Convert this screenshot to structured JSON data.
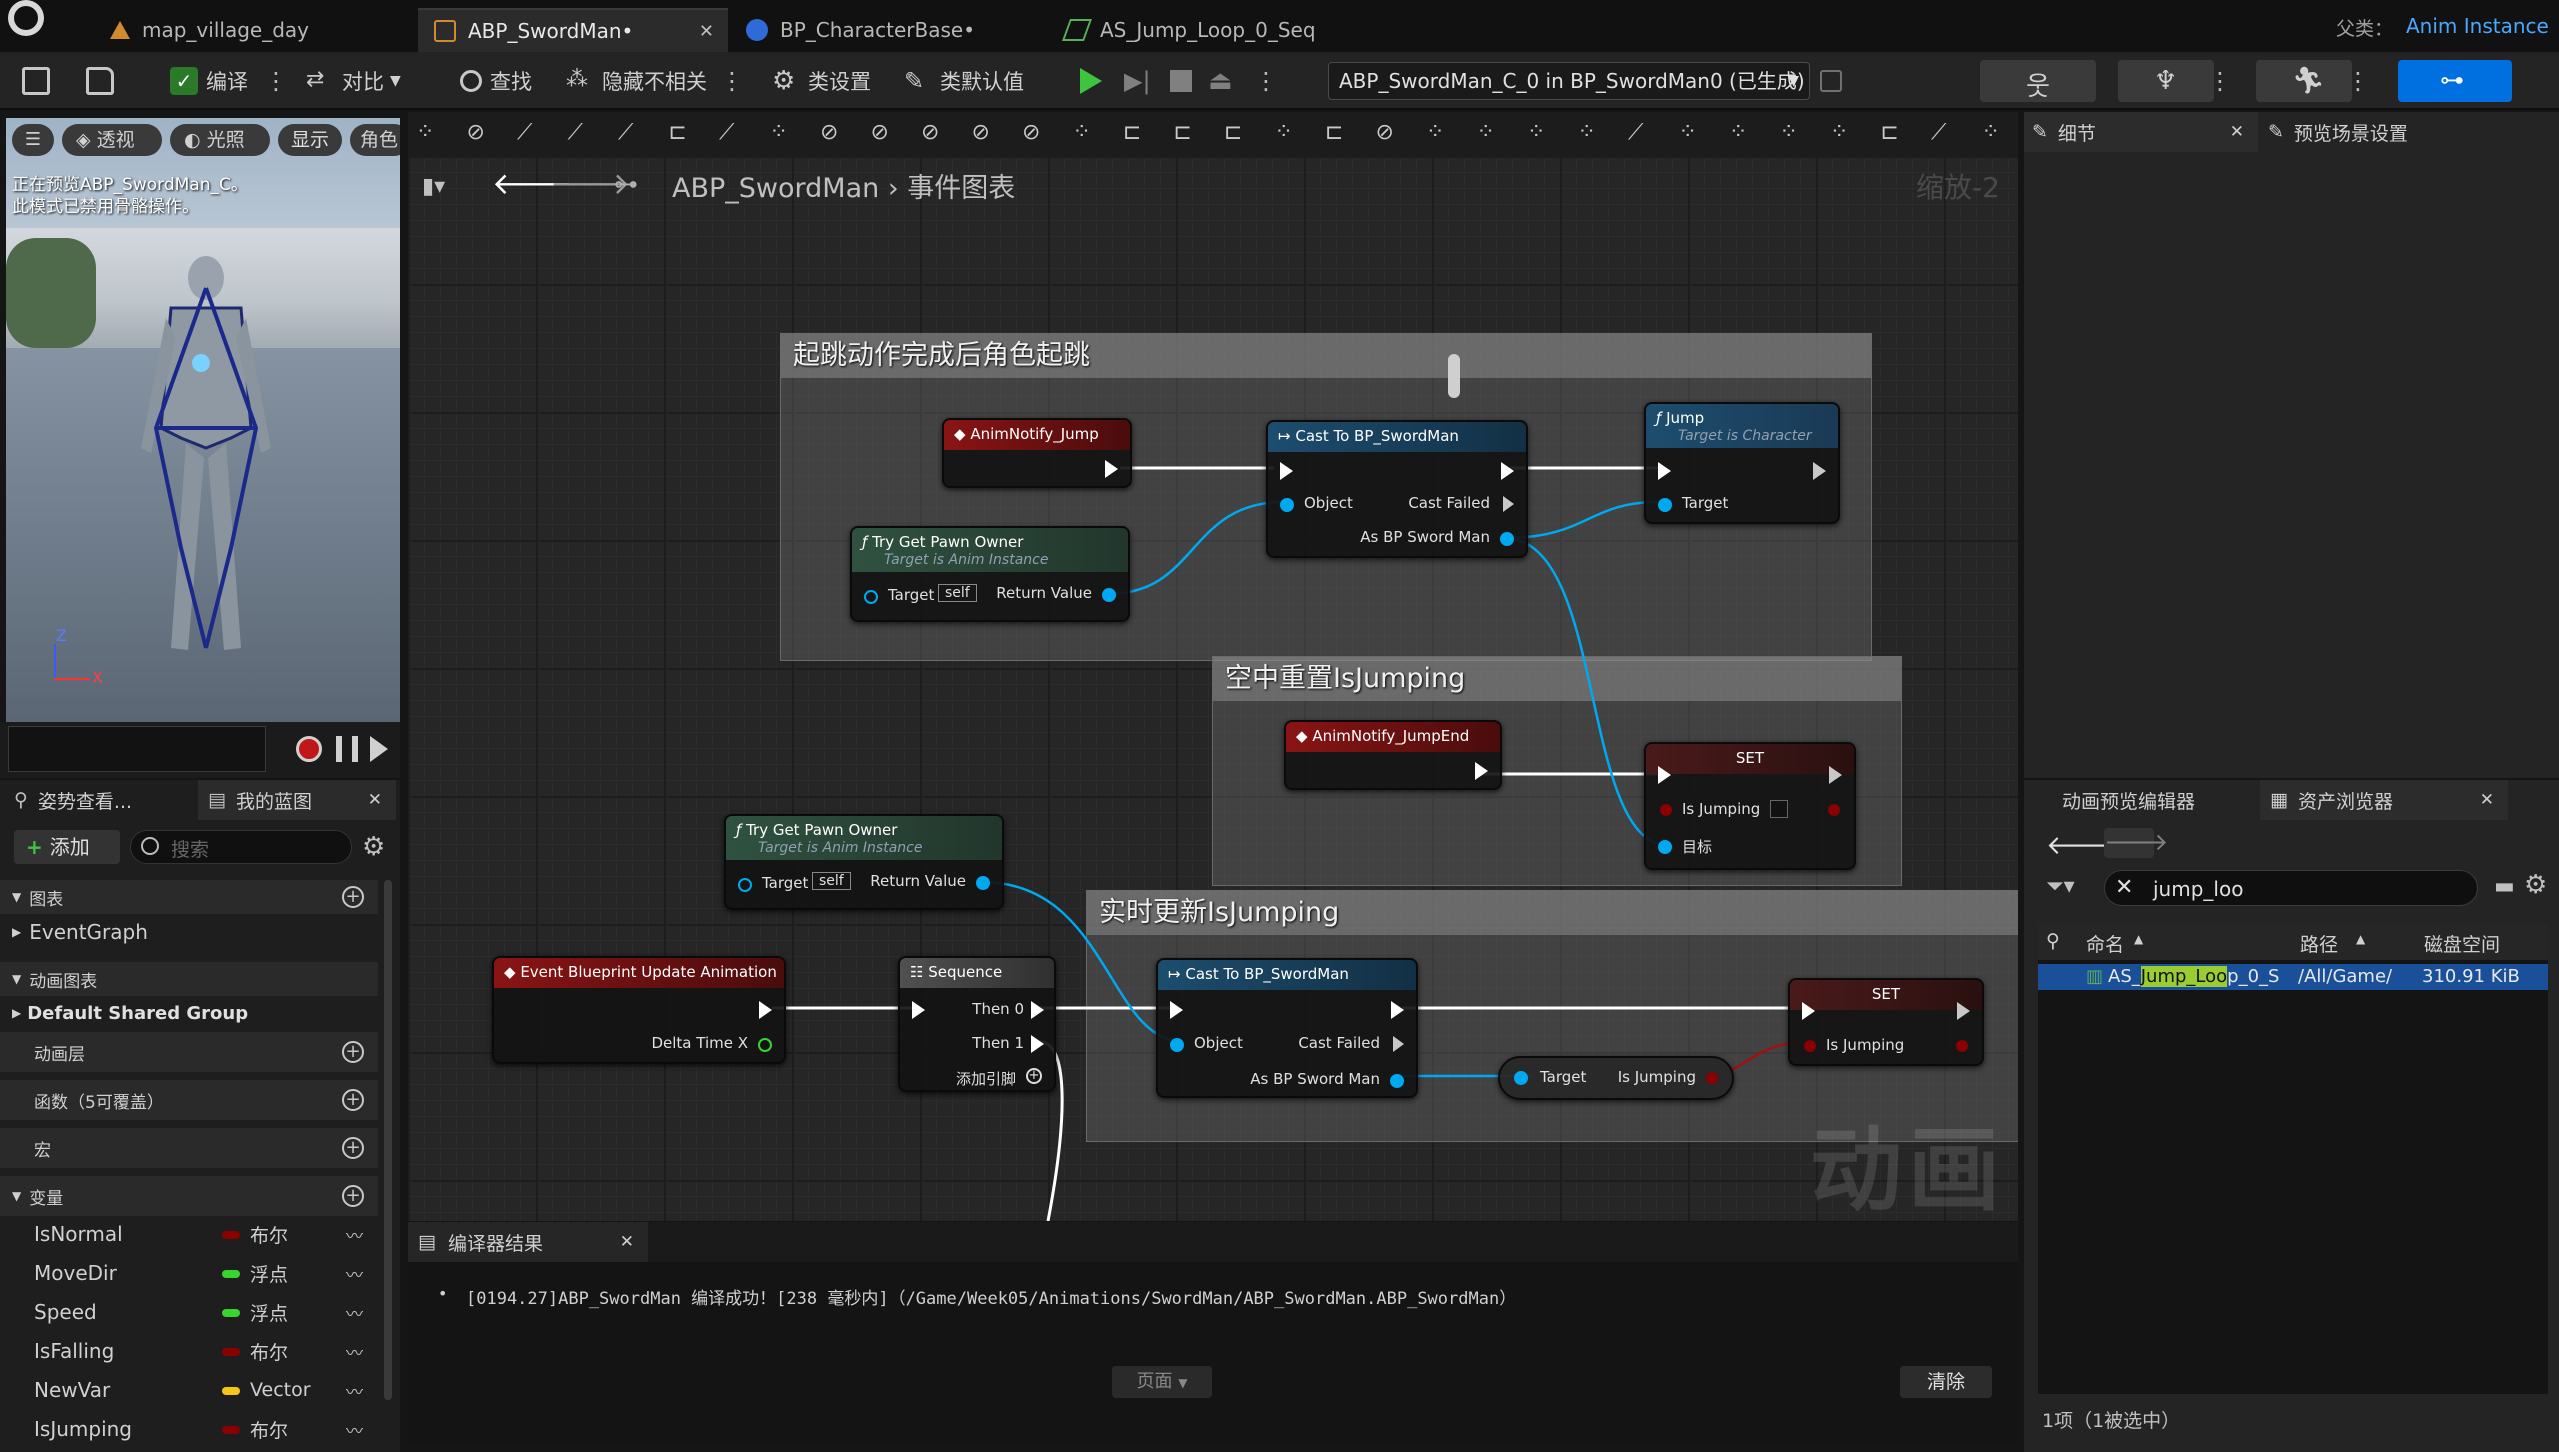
{
  "tabs": [
    {
      "label": "map_village_day",
      "icon": "level-icon"
    },
    {
      "label": "ABP_SwordMan•",
      "icon": "anim-blueprint-icon"
    },
    {
      "label": "BP_CharacterBase•",
      "icon": "blueprint-icon"
    },
    {
      "label": "AS_Jump_Loop_0_Seq",
      "icon": "sequence-icon"
    }
  ],
  "parent_class": {
    "label": "父类：",
    "value": "Anim Instance"
  },
  "toolbar": {
    "compile": "编译",
    "diff": "对比",
    "find": "查找",
    "hide_unrelated": "隐藏不相关",
    "class_settings": "类设置",
    "class_defaults": "类默认值",
    "debug_target": "ABP_SwordMan_C_0 in BP_SwordMan0 (已生成)"
  },
  "viewport": {
    "btn_perspective": "透视",
    "btn_lit": "光照",
    "btn_show": "显示",
    "btn_character": "角色",
    "message_line1": "正在预览ABP_SwordMan_C。",
    "message_line2": "此模式已禁用骨骼操作。",
    "axis_z": "Z",
    "axis_x": "X"
  },
  "left_panel": {
    "tab_pose": "姿势查看...",
    "tab_myblueprint": "我的蓝图",
    "add": "添加",
    "search_placeholder": "搜索",
    "sec_graphs": "图表",
    "event_graph": "EventGraph",
    "sec_anim_graphs": "动画图表",
    "default_group": "Default Shared Group",
    "sec_anim_layers": "动画层",
    "sec_functions": "函数（5可覆盖）",
    "sec_macros": "宏",
    "sec_variables": "变量",
    "variables": [
      {
        "name": "IsNormal",
        "type": "布尔",
        "color": "#8b0000"
      },
      {
        "name": "MoveDir",
        "type": "浮点",
        "color": "#38d530"
      },
      {
        "name": "Speed",
        "type": "浮点",
        "color": "#38d530"
      },
      {
        "name": "IsFalling",
        "type": "布尔",
        "color": "#8b0000"
      },
      {
        "name": "NewVar",
        "type": "Vector",
        "color": "#f5c518"
      },
      {
        "name": "IsJumping",
        "type": "布尔",
        "color": "#8b0000"
      }
    ]
  },
  "graph": {
    "breadcrumb_root": "ABP_SwordMan",
    "breadcrumb_leaf": "事件图表",
    "zoom": "缩放-2",
    "watermark": "动画",
    "comments": [
      {
        "title": "起跳动作完成后角色起跳"
      },
      {
        "title": "空中重置IsJumping"
      },
      {
        "title": "实时更新IsJumping"
      }
    ],
    "nodes": {
      "anim_notify_jump": "AnimNotify_Jump",
      "cast1": "Cast To BP_SwordMan",
      "jump": "Jump",
      "jump_sub": "Target is Character",
      "try_get1": "Try Get Pawn Owner",
      "try_get_sub": "Target is Anim Instance",
      "anim_notify_jumpend": "AnimNotify_JumpEnd",
      "set1": "SET",
      "try_get2": "Try Get Pawn Owner",
      "event_update": "Event Blueprint Update Animation",
      "sequence": "Sequence",
      "cast2": "Cast To BP_SwordMan",
      "set2": "SET"
    },
    "pins": {
      "object": "Object",
      "cast_failed": "Cast Failed",
      "as_bp_sword_man": "As BP Sword Man",
      "target": "Target",
      "self": "self",
      "return_value": "Return Value",
      "is_jumping": "Is Jumping",
      "target_cn": "目标",
      "delta_time": "Delta Time X",
      "then0": "Then 0",
      "then1": "Then 1",
      "add_pin": "添加引脚"
    }
  },
  "compiler": {
    "tab": "编译器结果",
    "message": "[0194.27]ABP_SwordMan 编译成功！[238 毫秒内]（/Game/Week05/Animations/SwordMan/ABP_SwordMan.ABP_SwordMan）",
    "page": "页面",
    "clear": "清除"
  },
  "right_panel": {
    "tab_details": "细节",
    "tab_preview_settings": "预览场景设置",
    "tab_anim_preview": "动画预览编辑器",
    "tab_asset_browser": "资产浏览器",
    "search_value": "jump_loo",
    "col_name": "命名",
    "col_path": "路径",
    "col_disk": "磁盘空间",
    "asset_row": {
      "name_pre": "AS_",
      "name_hl": "Jump_Loo",
      "name_post": "p_0_S",
      "path": "/All/Game/",
      "size": "310.91 KiB"
    },
    "status": "1项（1被选中）"
  },
  "colors": {
    "accent": "#0070e0",
    "event_red": "#7a1010",
    "cast_blue": "#1d4d6e",
    "func_green": "#2f5240",
    "pin_blue": "#00a8f0",
    "bool_red": "#8b0000"
  }
}
